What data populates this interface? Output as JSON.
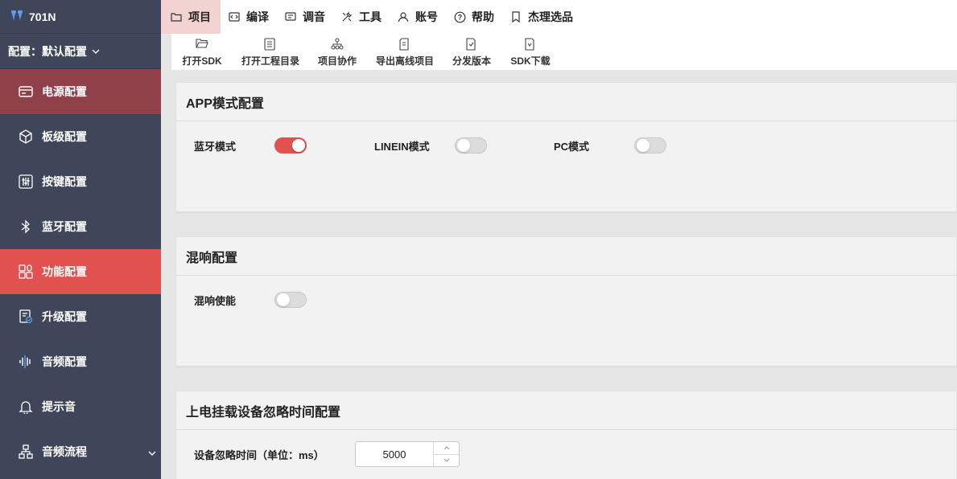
{
  "app": {
    "name": "701N"
  },
  "sidebar": {
    "config_label": "配置：默认配置",
    "items": [
      {
        "label": "电源配置",
        "icon": "power-panel-icon"
      },
      {
        "label": "板级配置",
        "icon": "cube-icon"
      },
      {
        "label": "按键配置",
        "icon": "sliders-icon"
      },
      {
        "label": "蓝牙配置",
        "icon": "bluetooth-icon"
      },
      {
        "label": "功能配置",
        "icon": "grid-apps-icon"
      },
      {
        "label": "升级配置",
        "icon": "upgrade-doc-icon"
      },
      {
        "label": "音频配置",
        "icon": "audio-wave-icon"
      },
      {
        "label": "提示音",
        "icon": "bell-icon"
      },
      {
        "label": "音频流程",
        "icon": "flow-icon"
      }
    ],
    "active_index": 4
  },
  "topmenu": {
    "items": [
      {
        "label": "项目",
        "icon": "folder-icon"
      },
      {
        "label": "编译",
        "icon": "code-icon"
      },
      {
        "label": "调音",
        "icon": "tune-icon"
      },
      {
        "label": "工具",
        "icon": "tools-icon"
      },
      {
        "label": "账号",
        "icon": "user-icon"
      },
      {
        "label": "帮助",
        "icon": "help-icon"
      },
      {
        "label": "杰理选品",
        "icon": "bookmark-icon"
      }
    ],
    "active_index": 0
  },
  "toolbar": {
    "items": [
      {
        "label": "打开SDK",
        "icon": "folder-open-icon"
      },
      {
        "label": "打开工程目录",
        "icon": "list-icon"
      },
      {
        "label": "项目协作",
        "icon": "share-icon"
      },
      {
        "label": "导出离线项目",
        "icon": "export-icon"
      },
      {
        "label": "分发版本",
        "icon": "distribute-icon"
      },
      {
        "label": "SDK下载",
        "icon": "download-icon"
      }
    ]
  },
  "panels": {
    "app_mode": {
      "title": "APP模式配置",
      "bt_label": "蓝牙模式",
      "bt_on": true,
      "linein_label": "LINEIN模式",
      "linein_on": false,
      "pc_label": "PC模式",
      "pc_on": false
    },
    "reverb": {
      "title": "混响配置",
      "enable_label": "混响使能",
      "enable_on": false
    },
    "power_on": {
      "title": "上电挂载设备忽略时间配置",
      "ignore_label": "设备忽略时间（单位：ms）",
      "ignore_value": "5000"
    }
  },
  "colors": {
    "accent": "#e05150",
    "sidebar_bg": "#404659",
    "power_bg": "#8f4049"
  }
}
